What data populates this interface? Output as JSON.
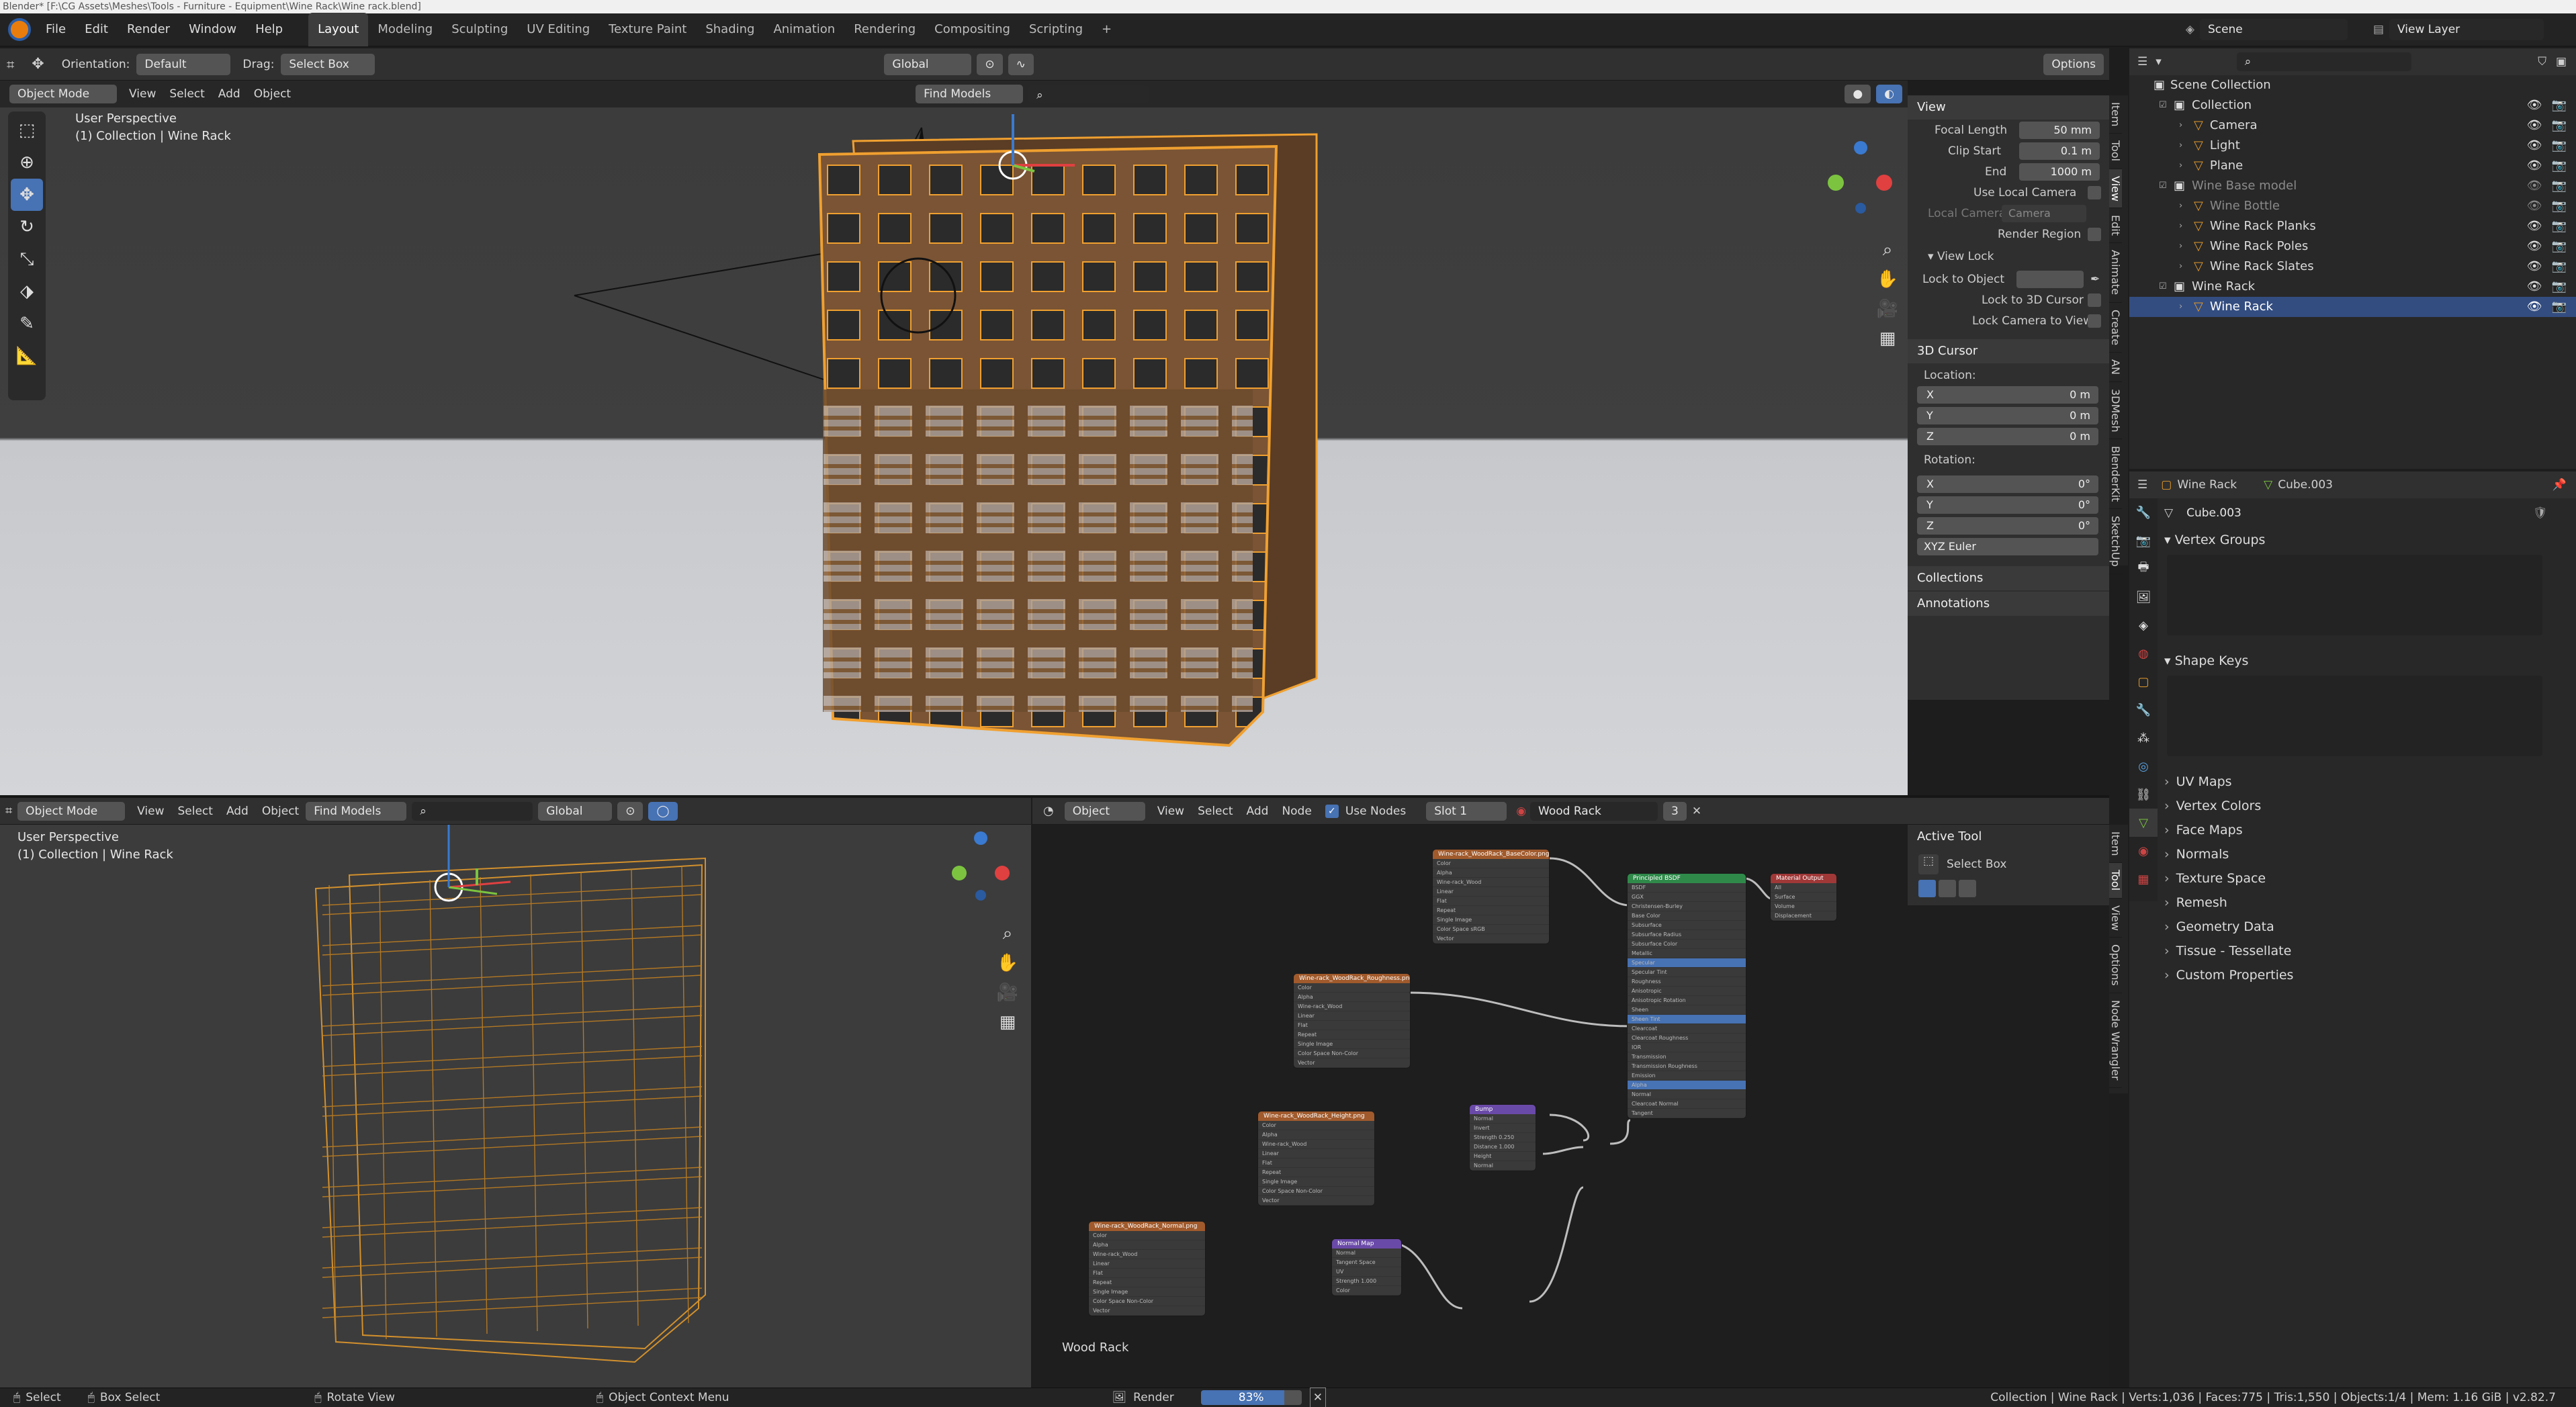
{
  "title_bar": "Blender* [F:\\CG Assets\\Meshes\\Tools - Furniture - Equipment\\Wine Rack\\Wine rack.blend]",
  "menu": [
    "File",
    "Edit",
    "Render",
    "Window",
    "Help"
  ],
  "workspaces": [
    "Layout",
    "Modeling",
    "Sculpting",
    "UV Editing",
    "Texture Paint",
    "Shading",
    "Animation",
    "Rendering",
    "Compositing",
    "Scripting",
    "+"
  ],
  "scene": {
    "label": "Scene",
    "view_layer": "View Layer"
  },
  "top_tool_header": {
    "orientation_label": "Orientation:",
    "orientation": "Default",
    "drag_label": "Drag:",
    "drag": "Select Box",
    "transform": "Global",
    "options": "Options"
  },
  "vp1_header": {
    "mode": "Object Mode",
    "menus": [
      "View",
      "Select",
      "Add",
      "Object"
    ],
    "find": "Find Models"
  },
  "vp1_overlay": {
    "line1": "User Perspective",
    "line2": "(1) Collection | Wine Rack"
  },
  "npanel": {
    "view_title": "View",
    "focal_label": "Focal Length",
    "focal": "50 mm",
    "clip_start_label": "Clip Start",
    "clip_start": "0.1 m",
    "end_label": "End",
    "end": "1000 m",
    "use_local_camera": "Use Local Camera",
    "local_camera": "Local Camera",
    "camera": "Camera",
    "render_region": "Render Region",
    "view_lock": "View Lock",
    "lock_to_object": "Lock to Object",
    "lock_3d_cursor": "Lock to 3D Cursor",
    "lock_camera": "Lock Camera to View",
    "cursor_title": "3D Cursor",
    "location": "Location:",
    "rotation": "Rotation:",
    "loc": [
      {
        "axis": "X",
        "val": "0 m"
      },
      {
        "axis": "Y",
        "val": "0 m"
      },
      {
        "axis": "Z",
        "val": "0 m"
      }
    ],
    "rot": [
      {
        "axis": "X",
        "val": "0°"
      },
      {
        "axis": "Y",
        "val": "0°"
      },
      {
        "axis": "Z",
        "val": "0°"
      }
    ],
    "euler": "XYZ Euler",
    "collections": "Collections",
    "annotations": "Annotations"
  },
  "vtabs_top": [
    "Item",
    "Tool",
    "View",
    "Edit",
    "Animate",
    "Create",
    "AN",
    "3DMesh",
    "BlenderKit",
    "SketchUp"
  ],
  "outliner": {
    "root": "Scene Collection",
    "rows": [
      {
        "name": "Collection",
        "indent": 1,
        "dim": false,
        "sel": false
      },
      {
        "name": "Camera",
        "indent": 2,
        "dim": false,
        "sel": false
      },
      {
        "name": "Light",
        "indent": 2,
        "dim": false,
        "sel": false
      },
      {
        "name": "Plane",
        "indent": 2,
        "dim": false,
        "sel": false
      },
      {
        "name": "Wine Base model",
        "indent": 1,
        "dim": true,
        "sel": false
      },
      {
        "name": "Wine Bottle",
        "indent": 2,
        "dim": true,
        "sel": false
      },
      {
        "name": "Wine Rack Planks",
        "indent": 2,
        "dim": false,
        "sel": false
      },
      {
        "name": "Wine Rack Poles",
        "indent": 2,
        "dim": false,
        "sel": false
      },
      {
        "name": "Wine Rack Slates",
        "indent": 2,
        "dim": false,
        "sel": false
      },
      {
        "name": "Wine Rack",
        "indent": 1,
        "dim": false,
        "sel": false
      },
      {
        "name": "Wine Rack",
        "indent": 2,
        "dim": false,
        "sel": true
      }
    ]
  },
  "properties": {
    "object": "Wine Rack",
    "mesh": "Cube.003",
    "data_name": "Cube.003",
    "vertex_groups": "Vertex Groups",
    "shape_keys": "Shape Keys",
    "groups": [
      "UV Maps",
      "Vertex Colors",
      "Face Maps",
      "Normals",
      "Texture Space",
      "Remesh",
      "Geometry Data",
      "Tissue - Tessellate",
      "Custom Properties"
    ]
  },
  "vp2_header": {
    "mode": "Object Mode",
    "menus": [
      "View",
      "Select",
      "Add",
      "Object"
    ],
    "find": "Find Models",
    "transform": "Global"
  },
  "vp2_overlay": {
    "line1": "User Perspective",
    "line2": "(1) Collection | Wine Rack"
  },
  "node_header": {
    "type": "Object",
    "menus": [
      "View",
      "Select",
      "Add",
      "Node"
    ],
    "use_nodes": "Use Nodes",
    "slot": "Slot 1",
    "material": "Wood Rack",
    "users": "3"
  },
  "node_editor_label": "Wood Rack",
  "nodes": {
    "principled": {
      "title": "Principled BSDF",
      "rows": [
        "BSDF",
        "GGX",
        "Christensen-Burley",
        "Base Color",
        "Subsurface",
        "Subsurface Radius",
        "Subsurface Color",
        "Metallic",
        "Specular",
        "Specular Tint",
        "Roughness",
        "Anisotropic",
        "Anisotropic Rotation",
        "Sheen",
        "Sheen Tint",
        "Clearcoat",
        "Clearcoat Roughness",
        "IOR",
        "Transmission",
        "Transmission Roughness",
        "Emission",
        "Alpha",
        "Normal",
        "Clearcoat Normal",
        "Tangent"
      ]
    },
    "output": {
      "title": "Material Output",
      "rows": [
        "All",
        "Surface",
        "Volume",
        "Displacement"
      ]
    },
    "tex_base": {
      "title": "Wine-rack_WoodRack_BaseColor.png",
      "rows": [
        "Color",
        "Alpha",
        "Wine-rack_Wood",
        "Linear",
        "Flat",
        "Repeat",
        "Single Image",
        "Color Space    sRGB",
        "Vector"
      ]
    },
    "tex_rough": {
      "title": "Wine-rack_WoodRack_Roughness.png",
      "rows": [
        "Color",
        "Alpha",
        "Wine-rack_Wood",
        "Linear",
        "Flat",
        "Repeat",
        "Single Image",
        "Color Space    Non-Color",
        "Vector"
      ]
    },
    "tex_height": {
      "title": "Wine-rack_WoodRack_Height.png",
      "rows": [
        "Color",
        "Alpha",
        "Wine-rack_Wood",
        "Linear",
        "Flat",
        "Repeat",
        "Single Image",
        "Color Space    Non-Color",
        "Vector"
      ]
    },
    "tex_normal": {
      "title": "Wine-rack_WoodRack_Normal.png",
      "rows": [
        "Color",
        "Alpha",
        "Wine-rack_Wood",
        "Linear",
        "Flat",
        "Repeat",
        "Single Image",
        "Color Space    Non-Color",
        "Vector"
      ]
    },
    "bump": {
      "title": "Bump",
      "rows": [
        "Normal",
        "Invert",
        "Strength    0.250",
        "Distance    1.000",
        "Height",
        "Normal"
      ]
    },
    "normalmap": {
      "title": "Normal Map",
      "rows": [
        "Normal",
        "Tangent Space",
        "UV",
        "Strength    1.000",
        "Color"
      ]
    }
  },
  "bottom_npanel": {
    "title": "Active Tool",
    "tool": "Select Box"
  },
  "vtabs_bottom": [
    "Item",
    "Tool",
    "View",
    "Options",
    "Node Wrangler"
  ],
  "status": {
    "select": "Select",
    "box_select": "Box Select",
    "rotate": "Rotate View",
    "context": "Object Context Menu",
    "render": "Render",
    "progress_label": "83%",
    "progress": 0.83,
    "stats": "Collection | Wine Rack | Verts:1,036 | Faces:775 | Tris:1,550 | Objects:1/4 | Mem: 1.16 GiB | v2.82.7"
  },
  "colors": {
    "accent": "#4772b3",
    "wood": "#8a6038",
    "select_orange": "#f0a030"
  }
}
